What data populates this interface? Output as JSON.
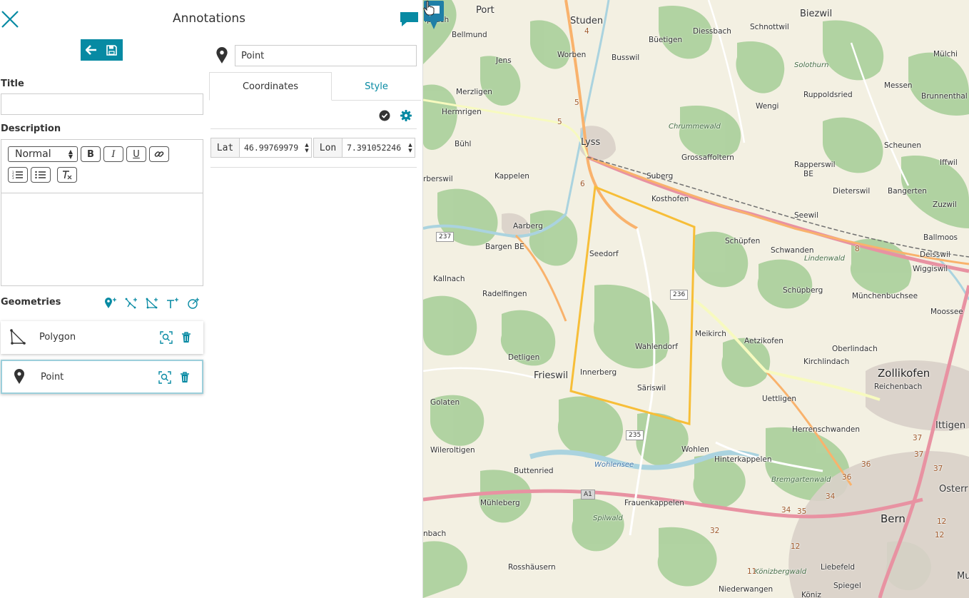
{
  "panel": {
    "title": "Annotations",
    "title_label": "Title",
    "title_value": "",
    "description_label": "Description",
    "format_select_value": "Normal",
    "geometries_label": "Geometries",
    "geometries": [
      {
        "label": "Polygon",
        "type": "polygon",
        "selected": false
      },
      {
        "label": "Point",
        "type": "point",
        "selected": true
      }
    ],
    "geometry_name_value": "Point",
    "tabs": [
      {
        "label": "Coordinates",
        "active": true
      },
      {
        "label": "Style",
        "active": false
      }
    ],
    "coordinates": {
      "lat_label": "Lat",
      "lat_value": "46.99769979",
      "lon_label": "Lon",
      "lon_value": "7.391052246"
    }
  },
  "icons": {
    "close": "close-icon",
    "comment": "comment-icon",
    "back": "arrow-left-icon",
    "save": "floppy-disk-icon",
    "add_point": "add-point-icon",
    "add_line": "add-line-icon",
    "add_polygon": "add-polygon-icon",
    "add_text": "add-text-icon",
    "add_circle": "add-circle-icon",
    "zoom_to": "zoom-to-icon",
    "delete": "trash-icon",
    "validate": "check-circle-icon",
    "settings": "gear-icon"
  },
  "colors": {
    "accent": "#078aa3",
    "annotation_polygon": "#f7be38",
    "forest": "#add19e",
    "motorway": "#e892a2",
    "primary_road": "#f9b26c",
    "water": "#aad3df"
  },
  "map": {
    "places": [
      {
        "name": "Port",
        "cls": "big"
      },
      {
        "name": "Studen",
        "cls": "big"
      },
      {
        "name": "Biezwil",
        "cls": "big"
      },
      {
        "name": "Ipsach",
        "cls": ""
      },
      {
        "name": "Schnottwil",
        "cls": ""
      },
      {
        "name": "Bellmund",
        "cls": ""
      },
      {
        "name": "Büetigen",
        "cls": ""
      },
      {
        "name": "Diessbach",
        "cls": ""
      },
      {
        "name": "Worben",
        "cls": ""
      },
      {
        "name": "Busswil",
        "cls": ""
      },
      {
        "name": "Mülchi",
        "cls": ""
      },
      {
        "name": "Jens",
        "cls": ""
      },
      {
        "name": "Solothurn",
        "cls": "ital"
      },
      {
        "name": "Merzligen",
        "cls": ""
      },
      {
        "name": "Ruppoldsried",
        "cls": ""
      },
      {
        "name": "Messen",
        "cls": ""
      },
      {
        "name": "Brunnenthal",
        "cls": ""
      },
      {
        "name": "Hermrigen",
        "cls": ""
      },
      {
        "name": "Wengi",
        "cls": ""
      },
      {
        "name": "Chrummewald",
        "cls": "ital"
      },
      {
        "name": "Bühl",
        "cls": ""
      },
      {
        "name": "Lyss",
        "cls": "big"
      },
      {
        "name": "Grossaffoltern",
        "cls": ""
      },
      {
        "name": "Scheunen",
        "cls": ""
      },
      {
        "name": "Iffwil",
        "cls": ""
      },
      {
        "name": "rberswil",
        "cls": ""
      },
      {
        "name": "Kappelen",
        "cls": ""
      },
      {
        "name": "Suberg",
        "cls": ""
      },
      {
        "name": "Rapperswil",
        "cls": ""
      },
      {
        "name": "BE",
        "cls": ""
      },
      {
        "name": "Dieterswil",
        "cls": ""
      },
      {
        "name": "Bangerten",
        "cls": ""
      },
      {
        "name": "Kosthofen",
        "cls": ""
      },
      {
        "name": "Zuzwil",
        "cls": ""
      },
      {
        "name": "Seewil",
        "cls": ""
      },
      {
        "name": "Aarberg",
        "cls": ""
      },
      {
        "name": "Ballmoos",
        "cls": ""
      },
      {
        "name": "Bargen BE",
        "cls": ""
      },
      {
        "name": "Schüpfen",
        "cls": ""
      },
      {
        "name": "Seedorf",
        "cls": ""
      },
      {
        "name": "Schwanden",
        "cls": ""
      },
      {
        "name": "Deisswil",
        "cls": ""
      },
      {
        "name": "Lindenwald",
        "cls": "ital"
      },
      {
        "name": "Wiggiswil",
        "cls": ""
      },
      {
        "name": "Kallnach",
        "cls": ""
      },
      {
        "name": "Radelfingen",
        "cls": ""
      },
      {
        "name": "Schüpberg",
        "cls": ""
      },
      {
        "name": "Münchenbuchsee",
        "cls": ""
      },
      {
        "name": "Moossee",
        "cls": ""
      },
      {
        "name": "Meikirch",
        "cls": ""
      },
      {
        "name": "Aetzikofen",
        "cls": ""
      },
      {
        "name": "Wahlendorf",
        "cls": ""
      },
      {
        "name": "Oberlindach",
        "cls": ""
      },
      {
        "name": "Detligen",
        "cls": ""
      },
      {
        "name": "Kirchlindach",
        "cls": ""
      },
      {
        "name": "Zollikofen",
        "cls": "city"
      },
      {
        "name": "Frieswil",
        "cls": "big"
      },
      {
        "name": "Innerberg",
        "cls": ""
      },
      {
        "name": "Reichenbach",
        "cls": ""
      },
      {
        "name": "Säriswil",
        "cls": ""
      },
      {
        "name": "Golaten",
        "cls": ""
      },
      {
        "name": "Uettligen",
        "cls": ""
      },
      {
        "name": "Ittigen",
        "cls": "big"
      },
      {
        "name": "Herrenschwanden",
        "cls": ""
      },
      {
        "name": "Wileroltigen",
        "cls": ""
      },
      {
        "name": "Wohlen",
        "cls": ""
      },
      {
        "name": "Hinterkappelen",
        "cls": ""
      },
      {
        "name": "Wohlensee",
        "cls": "water"
      },
      {
        "name": "Buttenried",
        "cls": ""
      },
      {
        "name": "Bremgartenwald",
        "cls": "ital"
      },
      {
        "name": "Osterr",
        "cls": "big"
      },
      {
        "name": "Mühleberg",
        "cls": ""
      },
      {
        "name": "Frauenkappelen",
        "cls": ""
      },
      {
        "name": "Spilwald",
        "cls": "ital"
      },
      {
        "name": "Bern",
        "cls": "city"
      },
      {
        "name": "nbach",
        "cls": ""
      },
      {
        "name": "Rosshäusern",
        "cls": ""
      },
      {
        "name": "Liebefeld",
        "cls": ""
      },
      {
        "name": "Könizbergwald",
        "cls": "ital"
      },
      {
        "name": "Mu",
        "cls": "big"
      },
      {
        "name": "Niederwangen",
        "cls": ""
      },
      {
        "name": "Spiegel",
        "cls": ""
      },
      {
        "name": "Köniz",
        "cls": ""
      }
    ],
    "shields": [
      {
        "label": "237",
        "cls": ""
      },
      {
        "label": "236",
        "cls": ""
      },
      {
        "label": "235",
        "cls": ""
      },
      {
        "label": "A1",
        "cls": "motor"
      }
    ],
    "road_numbers": [
      "4",
      "5",
      "5",
      "6",
      "8",
      "32",
      "34",
      "35",
      "34",
      "36",
      "36",
      "37",
      "37",
      "37",
      "12",
      "12",
      "12",
      "11"
    ]
  }
}
